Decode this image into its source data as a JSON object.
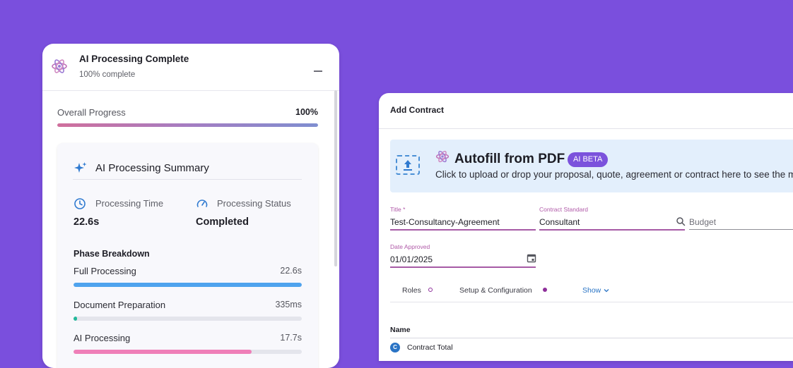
{
  "left_panel": {
    "title": "AI Processing Complete",
    "subtitle": "100% complete",
    "overall_label": "Overall Progress",
    "overall_value": "100%",
    "overall_fraction": 1.0,
    "summary": {
      "title": "AI Processing Summary",
      "time_label": "Processing Time",
      "time_value": "22.6s",
      "status_label": "Processing Status",
      "status_value": "Completed",
      "phase_title": "Phase Breakdown",
      "phases": [
        {
          "name": "Full Processing",
          "value": "22.6s",
          "fraction": 1.0,
          "color": "#4fa3ee"
        },
        {
          "name": "Document Preparation",
          "value": "335ms",
          "fraction": 0.015,
          "color": "#22b89a"
        },
        {
          "name": "AI Processing",
          "value": "17.7s",
          "fraction": 0.78,
          "color": "#ef7fb8"
        }
      ]
    }
  },
  "right_panel": {
    "title": "Add Contract",
    "autofill": {
      "title": "Autofill from PDF",
      "badge": "AI BETA",
      "description": "Click to upload or drop your proposal, quote, agreement or contract here to see the magic happen"
    },
    "fields": {
      "title_label": "Title *",
      "title_value": "Test-Consultancy-Agreement",
      "standard_label": "Contract Standard",
      "standard_value": "Consultant",
      "budget_placeholder": "Budget",
      "date_label": "Date Approved",
      "date_value": "01/01/2025"
    },
    "tabs": {
      "roles": "Roles",
      "setup": "Setup & Configuration",
      "show": "Show"
    },
    "table": {
      "header": "Name",
      "rows": [
        {
          "avatar": "C",
          "label": "Contract Total"
        }
      ]
    }
  },
  "colors": {
    "background": "#7a4fdd",
    "accent_purple": "#7b52dc",
    "field_underline": "#a65aa5",
    "link_blue": "#2a74c5"
  }
}
